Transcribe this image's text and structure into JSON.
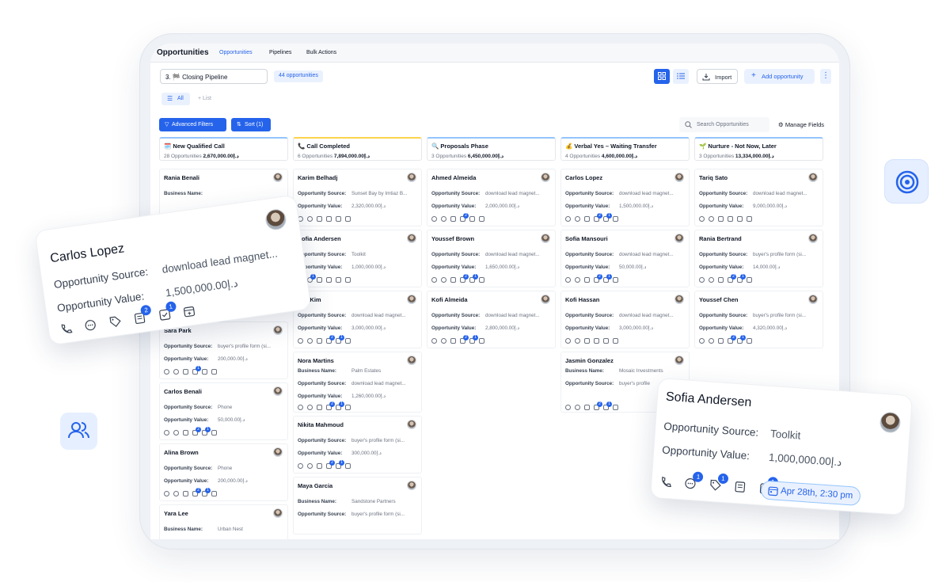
{
  "header": {
    "app_title": "Opportunities",
    "tabs": [
      {
        "label": "Opportunities",
        "active": true
      },
      {
        "label": "Pipelines",
        "active": false
      },
      {
        "label": "Bulk Actions",
        "active": false
      }
    ]
  },
  "toolbar": {
    "pipeline_select": "3. 🏁 Closing Pipeline",
    "count_badge": "44 opportunities",
    "import_label": "Import",
    "add_label": "Add opportunity",
    "view_all": "All",
    "view_list": "+ List",
    "advanced_filters": "Advanced Filters",
    "sort": "Sort (1)",
    "search_placeholder": "Search Opportunities",
    "manage_fields": "Manage Fields"
  },
  "labels": {
    "source": "Opportunity Source:",
    "value": "Opportunity Value:",
    "business": "Business Name:"
  },
  "columns": [
    {
      "title": "🗓️ New Qualified Call",
      "count": "28 Opportunities",
      "total": "2,670,000.00د.إ"
    },
    {
      "title": "📞 Call Completed",
      "count": "6 Opportunities",
      "total": "7,894,000.00د.إ"
    },
    {
      "title": "🔍 Proposals Phase",
      "count": "3 Opportunities",
      "total": "6,450,000.00د.إ"
    },
    {
      "title": "💰 Verbal Yes – Waiting Transfer",
      "count": "4 Opportunities",
      "total": "4,600,000.00د.إ"
    },
    {
      "title": "🌱 Nurture - Not Now, Later",
      "count": "3 Opportunities",
      "total": "13,334,000.00د.إ"
    }
  ],
  "cards": {
    "col0": [
      {
        "name": "Rania Benali",
        "l1": "Business Name:",
        "v1": "",
        "l2": "",
        "v2": ""
      },
      {
        "name": "Sara Park",
        "l1": "Opportunity Source:",
        "v1": "buyer's profile form (si...",
        "l2": "Opportunity Value:",
        "v2": "200,000.00د.إ"
      },
      {
        "name": "Carlos Benali",
        "l1": "Opportunity Source:",
        "v1": "Phone",
        "l2": "Opportunity Value:",
        "v2": "50,000.00د.إ"
      },
      {
        "name": "Alina Brown",
        "l1": "Opportunity Source:",
        "v1": "Phone",
        "l2": "Opportunity Value:",
        "v2": "200,000.00د.إ"
      },
      {
        "name": "Yara Lee",
        "l1": "Business Name:",
        "v1": "Urban Nest",
        "l2": "",
        "v2": ""
      }
    ],
    "col1": [
      {
        "name": "Karim Belhadj",
        "l1": "Opportunity Source:",
        "v1": "Sunset Bay by Imtiaz B...",
        "l2": "Opportunity Value:",
        "v2": "2,320,000.00د.إ"
      },
      {
        "name": "Sofia Andersen",
        "l1": "Opportunity Source:",
        "v1": "Toolkit",
        "l2": "Opportunity Value:",
        "v2": "1,000,000.00د.إ"
      },
      {
        "name": "Leo Kim",
        "l1": "Opportunity Source:",
        "v1": "download lead magnet...",
        "l2": "Opportunity Value:",
        "v2": "3,000,000.00د.إ"
      },
      {
        "name": "Nora Martins",
        "l1": "Business Name:",
        "v1": "Palm Estates",
        "l2": "Opportunity Source:",
        "v2": "download lead magnet...",
        "l3": "Opportunity Value:",
        "v3": "1,260,000.00د.إ"
      },
      {
        "name": "Nikita Mahmoud",
        "l1": "Opportunity Source:",
        "v1": "buyer's profile form (si...",
        "l2": "Opportunity Value:",
        "v2": "300,000.00د.إ"
      },
      {
        "name": "Maya Garcia",
        "l1": "Business Name:",
        "v1": "Sandstone Partners",
        "l2": "Opportunity Source:",
        "v2": "buyer's profile form (si..."
      }
    ],
    "col2": [
      {
        "name": "Ahmed Almeida",
        "l1": "Opportunity Source:",
        "v1": "download lead magnet...",
        "l2": "Opportunity Value:",
        "v2": "2,000,000.00د.إ"
      },
      {
        "name": "Youssef Brown",
        "l1": "Opportunity Source:",
        "v1": "download lead magnet...",
        "l2": "Opportunity Value:",
        "v2": "1,650,000.00د.إ"
      },
      {
        "name": "Kofi Almeida",
        "l1": "Opportunity Source:",
        "v1": "download lead magnet...",
        "l2": "Opportunity Value:",
        "v2": "2,800,000.00د.إ"
      }
    ],
    "col3": [
      {
        "name": "Carlos Lopez",
        "l1": "Opportunity Source:",
        "v1": "download lead magnet...",
        "l2": "Opportunity Value:",
        "v2": "1,500,000.00د.إ"
      },
      {
        "name": "Sofia Mansouri",
        "l1": "Opportunity Source:",
        "v1": "download lead magnet...",
        "l2": "Opportunity Value:",
        "v2": "50,000.00د.إ"
      },
      {
        "name": "Kofi Hassan",
        "l1": "Opportunity Source:",
        "v1": "download lead magnet...",
        "l2": "Opportunity Value:",
        "v2": "3,000,000.00د.إ"
      },
      {
        "name": "Jasmin Gonzalez",
        "l1": "Business Name:",
        "v1": "Mosaic Investments",
        "l2": "Opportunity Source:",
        "v2": "buyer's profile"
      }
    ],
    "col4": [
      {
        "name": "Tariq Sato",
        "l1": "Opportunity Source:",
        "v1": "download lead magnet...",
        "l2": "Opportunity Value:",
        "v2": "9,000,000.00د.إ"
      },
      {
        "name": "Rania Bertrand",
        "l1": "Opportunity Source:",
        "v1": "buyer's profile form (si...",
        "l2": "Opportunity Value:",
        "v2": "14,000.00د.إ"
      },
      {
        "name": "Youssef Chen",
        "l1": "Opportunity Source:",
        "v1": "buyer's profile form (si...",
        "l2": "Opportunity Value:",
        "v2": "4,320,000.00د.إ"
      }
    ]
  },
  "float_left": {
    "name": "Carlos Lopez",
    "source_label": "Opportunity Source:",
    "source_value": "download lead magnet...",
    "value_label": "Opportunity Value:",
    "value_value": "1,500,000.00د.إ",
    "badges": [
      "2",
      "1"
    ]
  },
  "float_right": {
    "name": "Sofia Andersen",
    "source_label": "Opportunity Source:",
    "source_value": "Toolkit",
    "value_label": "Opportunity Value:",
    "value_value": "1,000,000.00د.إ",
    "badges": [
      "1",
      "1",
      "1"
    ],
    "date": "Apr 28th, 2:30 pm"
  },
  "colors": {
    "accent": "#2563eb",
    "accent_light": "#eaf1fe"
  }
}
